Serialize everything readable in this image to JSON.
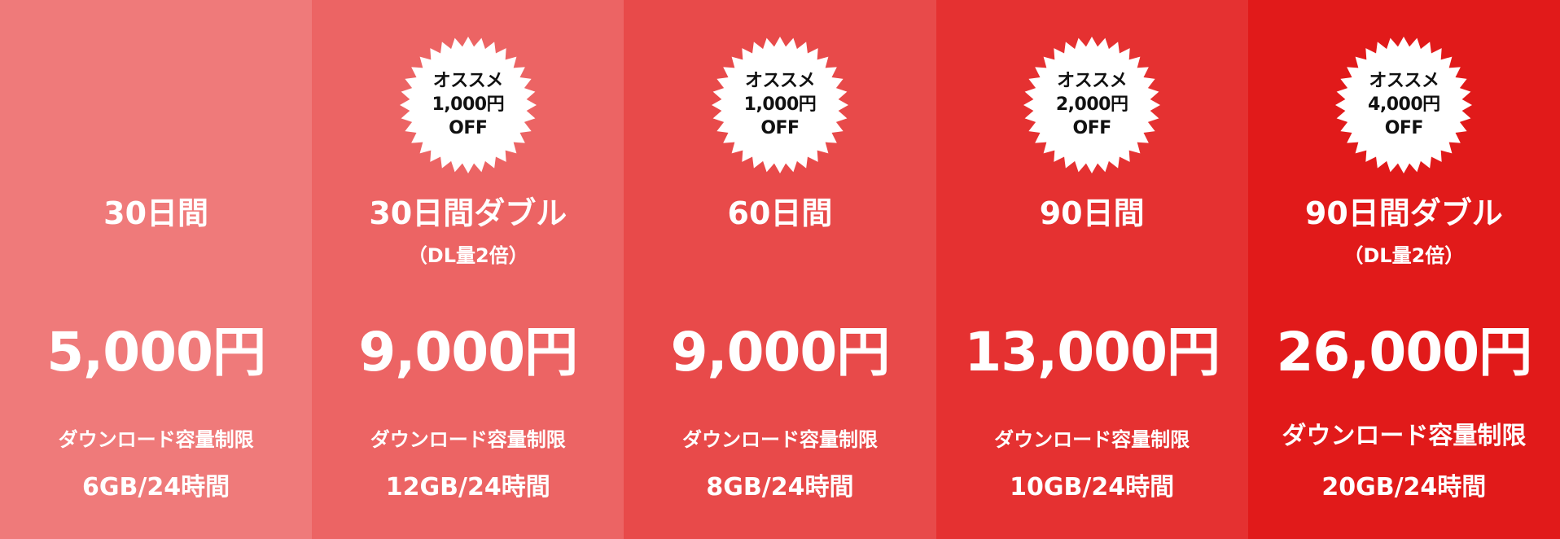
{
  "plans": [
    {
      "color": "#ef7a7a",
      "name": "30日間",
      "note": "",
      "price": "5,000円",
      "limit_label": "ダウンロード容量制限",
      "limit_value": "6GB/24時間",
      "badge": null
    },
    {
      "color": "#ec6464",
      "name": "30日間ダブル",
      "note": "（DL量2倍）",
      "price": "9,000円",
      "limit_label": "ダウンロード容量制限",
      "limit_value": "12GB/24時間",
      "badge": {
        "line1": "オススメ",
        "line2": "1,000円",
        "line3": "OFF"
      }
    },
    {
      "color": "#e84a4a",
      "name": "60日間",
      "note": "",
      "price": "9,000円",
      "limit_label": "ダウンロード容量制限",
      "limit_value": "8GB/24時間",
      "badge": {
        "line1": "オススメ",
        "line2": "1,000円",
        "line3": "OFF"
      }
    },
    {
      "color": "#e53131",
      "name": "90日間",
      "note": "",
      "price": "13,000円",
      "limit_label": "ダウンロード容量制限",
      "limit_value": "10GB/24時間",
      "badge": {
        "line1": "オススメ",
        "line2": "2,000円",
        "line3": "OFF"
      }
    },
    {
      "color": "#e11a1a",
      "name": "90日間ダブル",
      "note": "（DL量2倍）",
      "price": "26,000円",
      "limit_label": "ダウンロード容量制限",
      "limit_value": "20GB/24時間",
      "badge": {
        "line1": "オススメ",
        "line2": "4,000円",
        "line3": "OFF"
      }
    }
  ]
}
